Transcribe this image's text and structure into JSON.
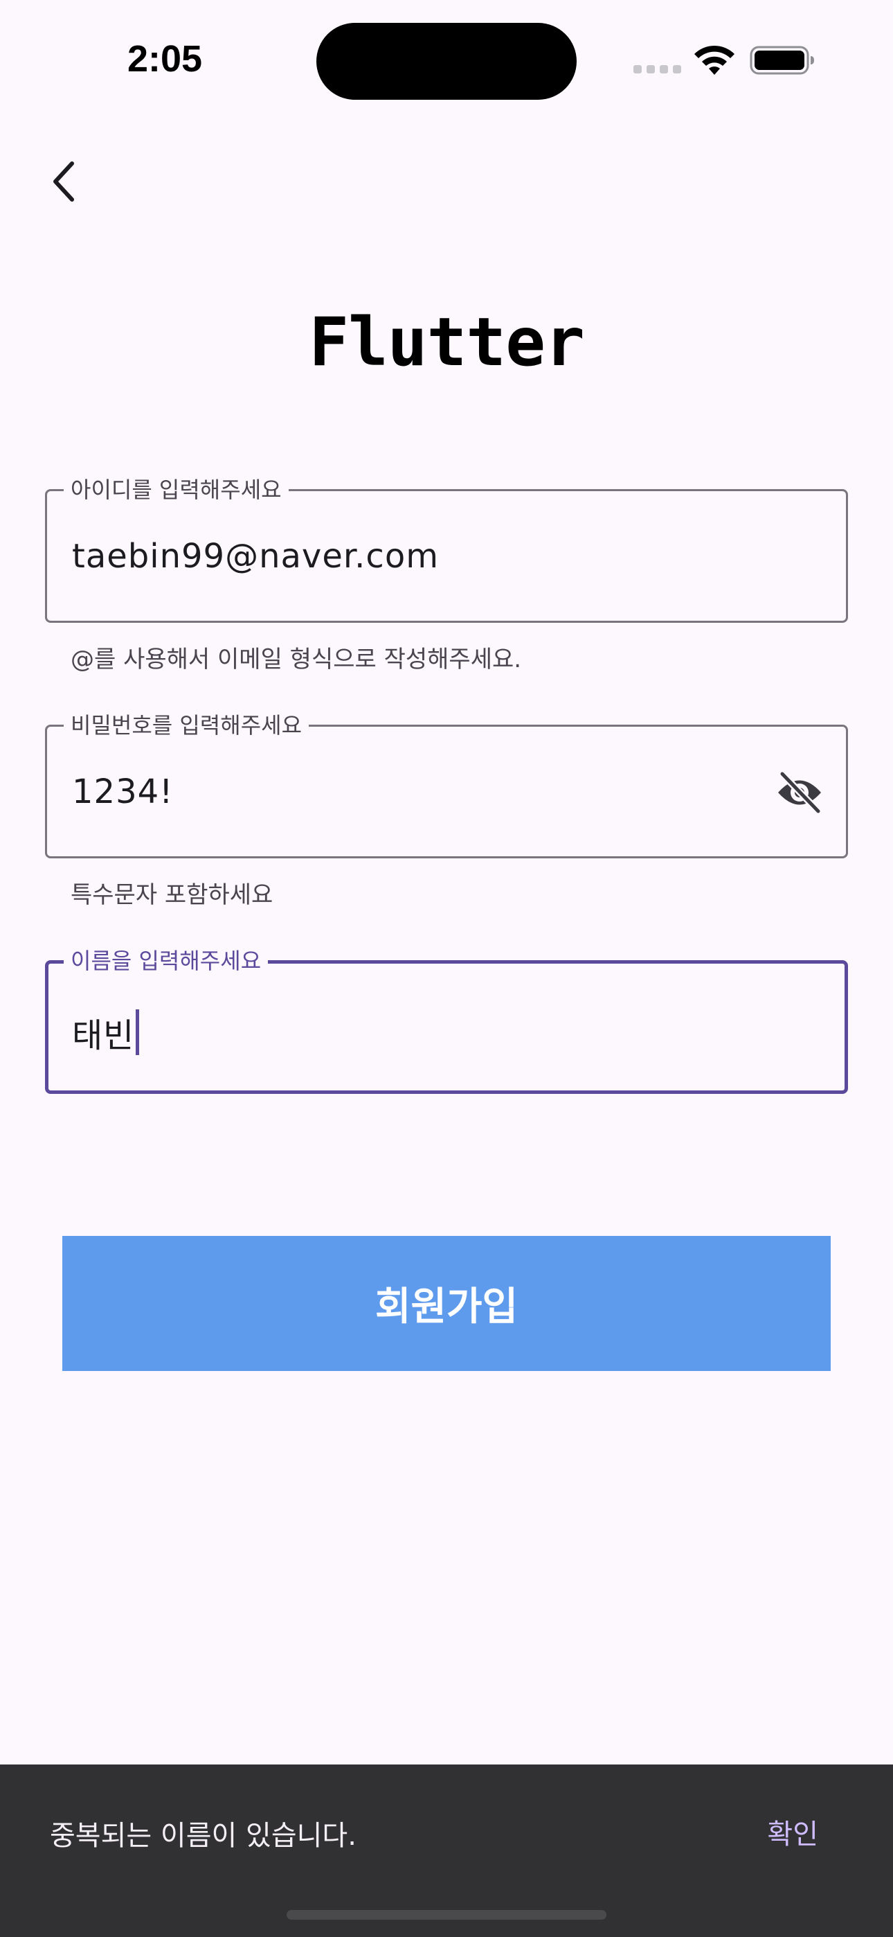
{
  "status_bar": {
    "time": "2:05"
  },
  "header": {
    "back_icon": "chevron-left-icon"
  },
  "title": "Flutter",
  "form": {
    "email": {
      "label": "아이디를 입력해주세요",
      "value": "taebin99@naver.com",
      "helper": "@를 사용해서 이메일 형식으로 작성해주세요."
    },
    "password": {
      "label": "비밀번호를 입력해주세요",
      "value": "1234!",
      "helper": "특수문자 포함하세요",
      "toggle_icon": "visibility-off-icon"
    },
    "name": {
      "label": "이름을 입력해주세요",
      "value": "태빈"
    }
  },
  "signup_button": {
    "label": "회원가입"
  },
  "snackbar": {
    "message": "중복되는 이름이 있습니다.",
    "action": "확인"
  },
  "colors": {
    "background": "#fdf8fd",
    "focus": "#5b4a9c",
    "button": "#5f9bec",
    "snackbar": "#313033",
    "snackbar_action": "#cfbcff"
  }
}
